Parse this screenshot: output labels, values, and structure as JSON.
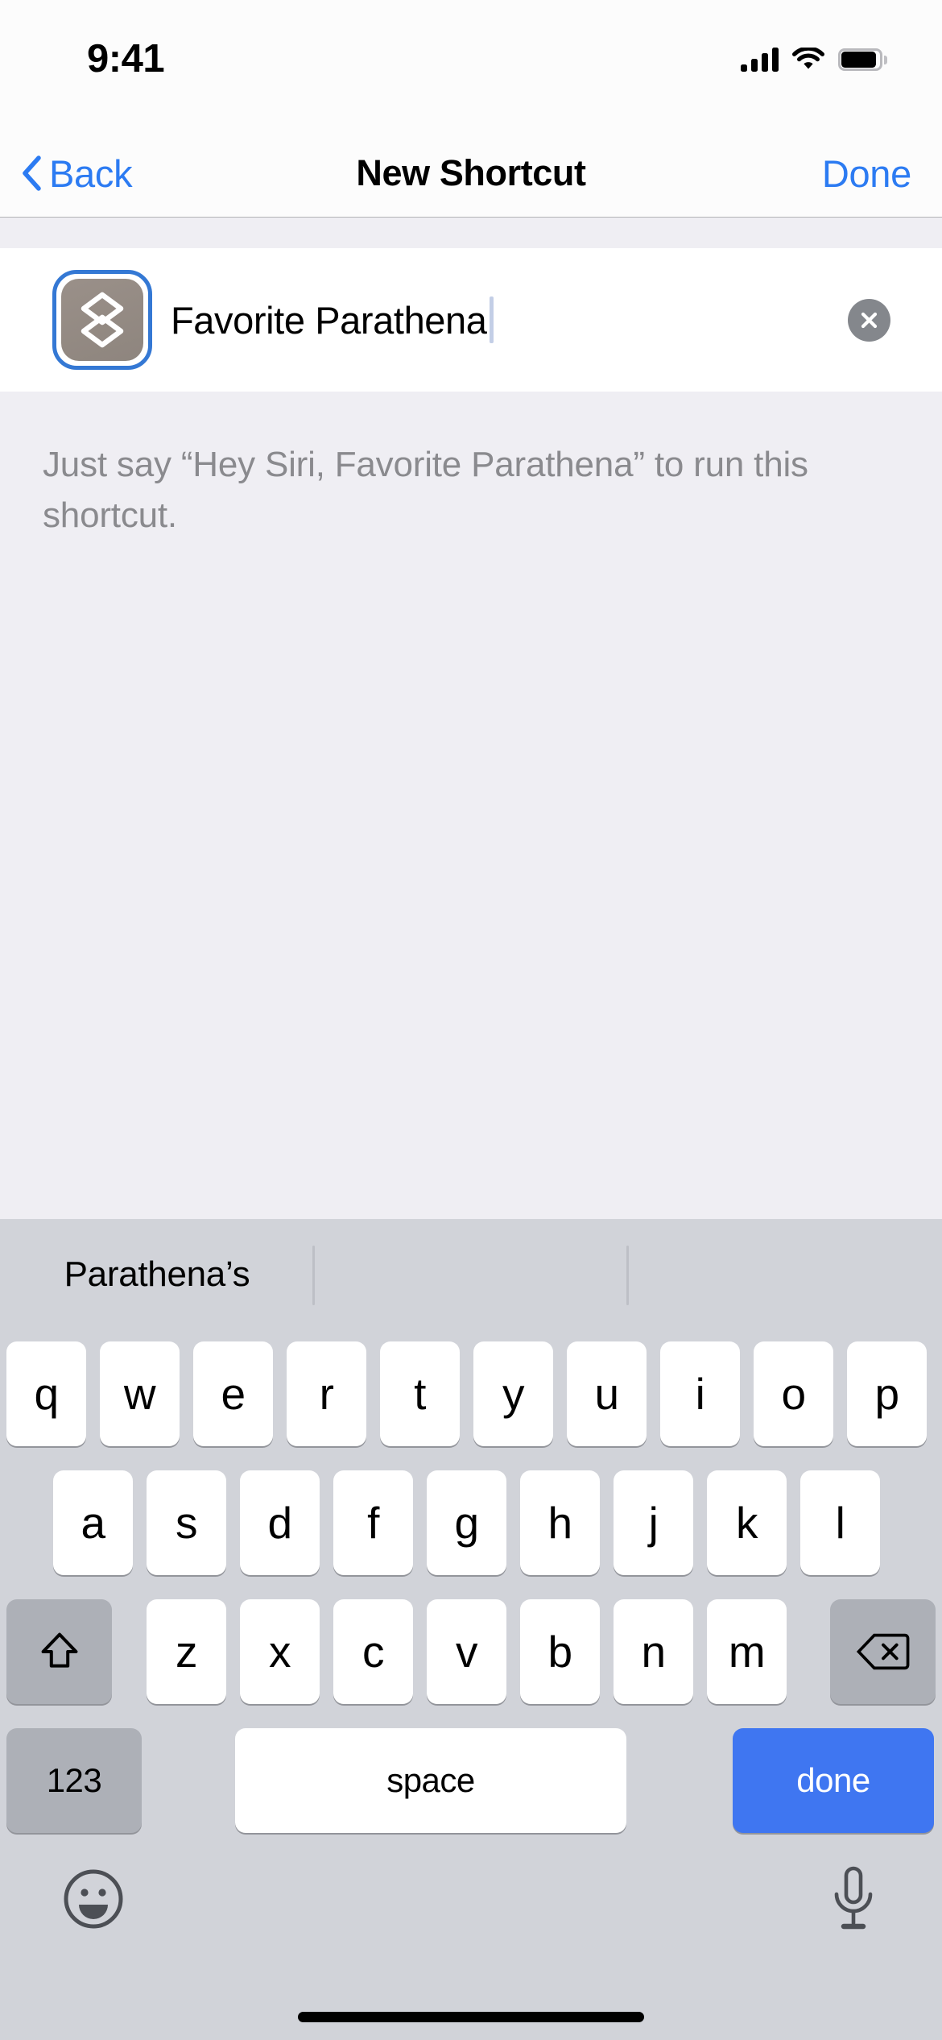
{
  "status_bar": {
    "time": "9:41",
    "icons": [
      "cellular-signal-icon",
      "wifi-icon",
      "battery-icon"
    ],
    "signal_bars": 4,
    "battery_level": "full"
  },
  "nav_bar": {
    "back_label": "Back",
    "back_icon": "chevron-left-icon",
    "title": "New Shortcut",
    "done_label": "Done",
    "accent_color": "#2C7BF2"
  },
  "name_row": {
    "icon_name": "shortcut-layers-icon",
    "icon_tile_color": "#92887F",
    "icon_focus_ring_color": "#3478D4",
    "input_value": "Favorite Parathena",
    "input_placeholder": "Shortcut Name",
    "clear_icon": "clear-circle-x-icon"
  },
  "siri_hint": {
    "text": "Just say “Hey Siri, Favorite Parathena” to run this shortcut."
  },
  "keyboard": {
    "predictions": [
      "Parathena’s",
      "",
      ""
    ],
    "rows": [
      [
        "q",
        "w",
        "e",
        "r",
        "t",
        "y",
        "u",
        "i",
        "o",
        "p"
      ],
      [
        "a",
        "s",
        "d",
        "f",
        "g",
        "h",
        "j",
        "k",
        "l"
      ],
      [
        "z",
        "x",
        "c",
        "v",
        "b",
        "n",
        "m"
      ]
    ],
    "shift_icon": "shift-arrow-up-icon",
    "delete_icon": "delete-backspace-icon",
    "numeric_label": "123",
    "space_label": "space",
    "return_label": "done",
    "return_color": "#3F76F1",
    "emoji_icon": "emoji-smiley-icon",
    "dictation_icon": "microphone-icon",
    "key_color": "#FFFFFF",
    "modifier_key_color": "#ADB0B7",
    "background_color": "#D1D3D9"
  },
  "home_indicator": "home-indicator-bar"
}
